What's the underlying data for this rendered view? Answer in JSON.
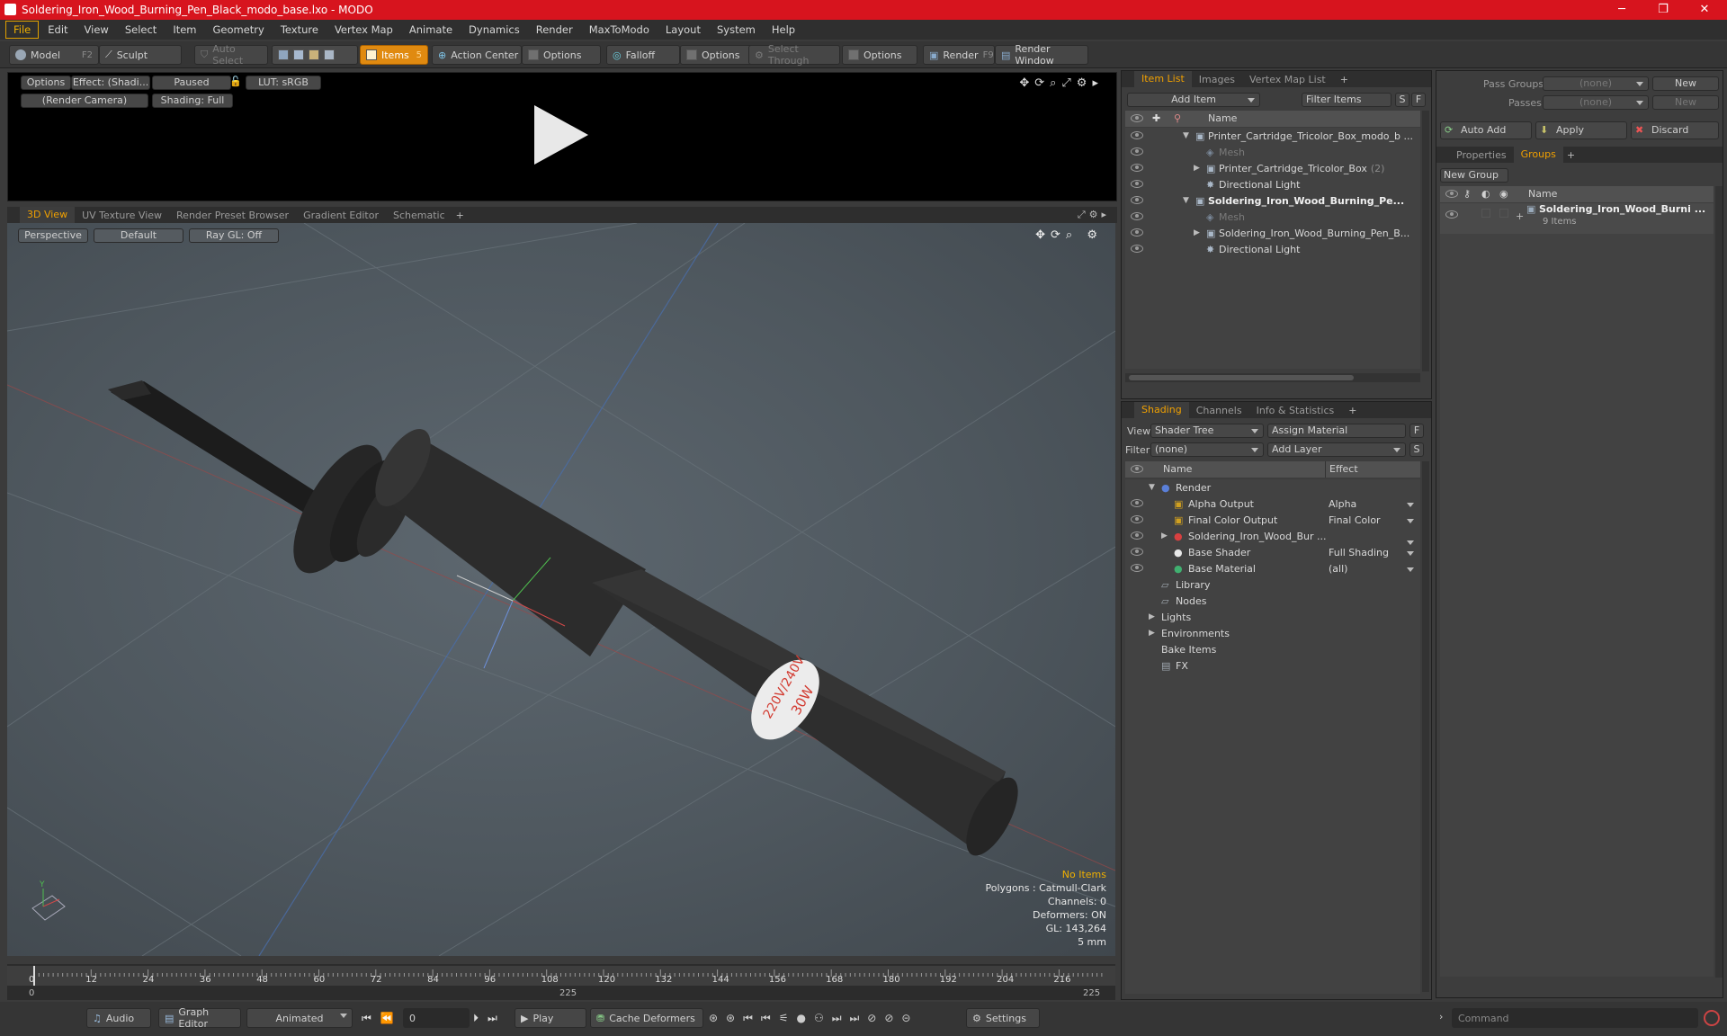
{
  "window": {
    "title": "Soldering_Iron_Wood_Burning_Pen_Black_modo_base.lxo - MODO",
    "minimize": "─",
    "maximize": "❐",
    "close": "✕"
  },
  "menu": [
    "File",
    "Edit",
    "View",
    "Select",
    "Item",
    "Geometry",
    "Texture",
    "Vertex Map",
    "Animate",
    "Dynamics",
    "Render",
    "MaxToModo",
    "Layout",
    "System",
    "Help"
  ],
  "toolbar": {
    "model": "Model",
    "model_key": "F2",
    "sculpt": "Sculpt",
    "auto_select": "Auto Select",
    "items": "Items",
    "items_key": "5",
    "action_center": "Action Center",
    "options1": "Options",
    "falloff": "Falloff",
    "options2": "Options",
    "select_through": "Select Through",
    "options3": "Options",
    "render": "Render",
    "render_key": "F9",
    "render_window": "Render Window"
  },
  "preview": {
    "options": "Options",
    "effect": "Effect: (Shadi...",
    "paused": "Paused",
    "lut": "LUT: sRGB",
    "camera": "(Render Camera)",
    "shading": "Shading: Full"
  },
  "viewport_tabs": [
    "3D View",
    "UV Texture View",
    "Render Preset Browser",
    "Gradient Editor",
    "Schematic"
  ],
  "viewport": {
    "perspective": "Perspective",
    "default": "Default",
    "raygl": "Ray GL: Off",
    "label_text_1": "220V/240V",
    "label_text_2": "30W",
    "info": {
      "no_items": "No Items",
      "polygons": "Polygons : Catmull-Clark",
      "channels": "Channels: 0",
      "deformers": "Deformers: ON",
      "gl": "GL: 143,264",
      "scale": "5 mm"
    }
  },
  "item_list": {
    "tabs": [
      "Item List",
      "Images",
      "Vertex Map List"
    ],
    "add_item": "Add Item",
    "filter_items": "Filter Items",
    "s": "S",
    "f": "F",
    "col_name": "Name",
    "rows": [
      {
        "label": "Printer_Cartridge_Tricolor_Box_modo_b ...",
        "level": 0
      },
      {
        "label": "Mesh",
        "level": 1,
        "dim": true
      },
      {
        "label": "Printer_Cartridge_Tricolor_Box",
        "suffix": "(2)",
        "level": 1
      },
      {
        "label": "Directional Light",
        "level": 1
      },
      {
        "label": "Soldering_Iron_Wood_Burning_Pe...",
        "level": 0,
        "bold": true
      },
      {
        "label": "Mesh",
        "level": 1,
        "dim": true
      },
      {
        "label": "Soldering_Iron_Wood_Burning_Pen_B...",
        "level": 1
      },
      {
        "label": "Directional Light",
        "level": 1
      }
    ]
  },
  "shading": {
    "tabs": [
      "Shading",
      "Channels",
      "Info & Statistics"
    ],
    "view_label": "View",
    "view_value": "Shader Tree",
    "assign_material": "Assign Material",
    "filter_label": "Filter",
    "filter_value": "(none)",
    "add_layer": "Add Layer",
    "f": "F",
    "s": "S",
    "col_name": "Name",
    "col_effect": "Effect",
    "rows": [
      {
        "label": "Render",
        "effect": ""
      },
      {
        "label": "Alpha Output",
        "effect": "Alpha"
      },
      {
        "label": "Final Color Output",
        "effect": "Final Color"
      },
      {
        "label": "Soldering_Iron_Wood_Bur ...",
        "effect": ""
      },
      {
        "label": "Base Shader",
        "effect": "Full Shading"
      },
      {
        "label": "Base Material",
        "effect": "(all)"
      },
      {
        "label": "Library",
        "effect": ""
      },
      {
        "label": "Nodes",
        "effect": ""
      },
      {
        "label": "Lights",
        "effect": ""
      },
      {
        "label": "Environments",
        "effect": ""
      },
      {
        "label": "Bake Items",
        "effect": ""
      },
      {
        "label": "FX",
        "effect": ""
      }
    ]
  },
  "groups": {
    "pass_groups": "Pass Groups",
    "passes": "Passes",
    "none": "(none)",
    "new": "New",
    "auto_add": "Auto Add",
    "apply": "Apply",
    "discard": "Discard",
    "tabs": [
      "Properties",
      "Groups"
    ],
    "new_group": "New Group",
    "col_name": "Name",
    "group_name": "Soldering_Iron_Wood_Burni ...",
    "group_count": "9 Items"
  },
  "timeline": {
    "ticks": [
      "0",
      "12",
      "24",
      "36",
      "48",
      "60",
      "72",
      "84",
      "96",
      "108",
      "120",
      "132",
      "144",
      "156",
      "168",
      "180",
      "192",
      "204",
      "216"
    ],
    "range_start": "0",
    "range_mid": "225",
    "range_end": "225"
  },
  "bottombar": {
    "audio": "Audio",
    "graph_editor": "Graph Editor",
    "animated": "Animated",
    "frame": "0",
    "play": "Play",
    "cache_deformers": "Cache Deformers",
    "settings": "Settings",
    "command": "Command"
  }
}
